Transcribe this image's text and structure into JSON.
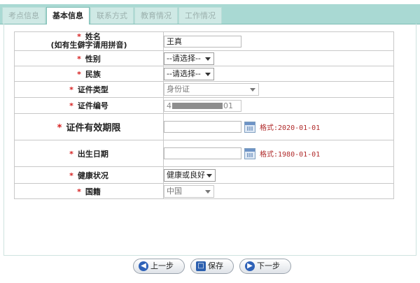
{
  "tabs": [
    {
      "label": "考点信息",
      "active": false
    },
    {
      "label": "基本信息",
      "active": true
    },
    {
      "label": "联系方式",
      "active": false
    },
    {
      "label": "教育情况",
      "active": false
    },
    {
      "label": "工作情况",
      "active": false
    }
  ],
  "form": {
    "required_mark": "*",
    "name": {
      "label": "姓名",
      "sublabel": "(如有生僻字请用拼音)",
      "value": "王真"
    },
    "gender": {
      "label": "性别",
      "value": "--请选择--"
    },
    "ethnicity": {
      "label": "民族",
      "value": "--请选择--"
    },
    "id_type": {
      "label": "证件类型",
      "value": "身份证"
    },
    "id_number": {
      "label": "证件编号",
      "value_prefix": "4",
      "value_suffix": "01"
    },
    "id_validity": {
      "label": "证件有效期限",
      "value": "",
      "hint": "格式:2020-01-01"
    },
    "birth_date": {
      "label": "出生日期",
      "value": "",
      "hint": "格式:1980-01-01"
    },
    "health": {
      "label": "健康状况",
      "value": "健康或良好"
    },
    "nationality": {
      "label": "国籍",
      "value": "中国"
    }
  },
  "buttons": {
    "prev": "上一步",
    "save": "保存",
    "next": "下一步"
  },
  "icons": {
    "prev": "arrow-left-icon",
    "save": "floppy-disk-icon",
    "next": "arrow-right-icon",
    "calendar": "calendar-icon"
  }
}
